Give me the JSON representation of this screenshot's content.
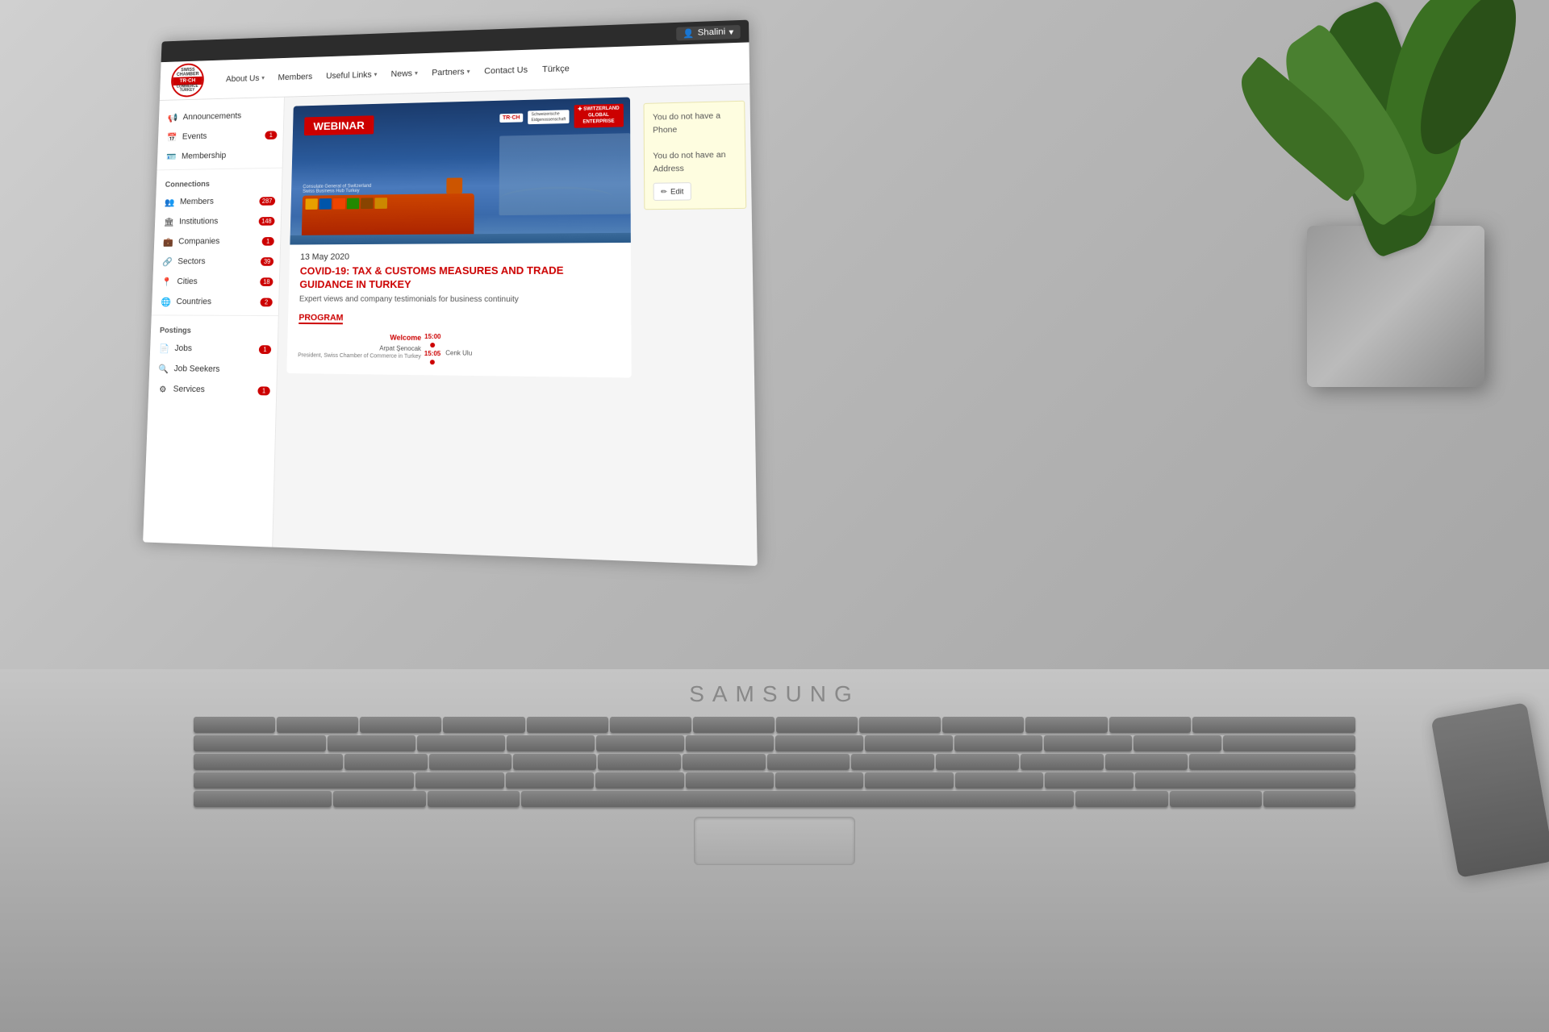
{
  "colors": {
    "primary": "#cc0000",
    "dark": "#2c2c2c",
    "light_bg": "#f5f5f5",
    "note_bg": "#fefde0",
    "sidebar_bg": "#ffffff"
  },
  "topbar": {
    "username": "Shalini",
    "dropdown_icon": "▾"
  },
  "navbar": {
    "logo_text": "TR·CH",
    "items": [
      {
        "label": "About Us",
        "has_dropdown": true
      },
      {
        "label": "Members",
        "has_dropdown": false
      },
      {
        "label": "Useful Links",
        "has_dropdown": true
      },
      {
        "label": "News",
        "has_dropdown": true
      },
      {
        "label": "Partners",
        "has_dropdown": true
      },
      {
        "label": "Contact Us",
        "has_dropdown": false
      },
      {
        "label": "Türkçe",
        "has_dropdown": false
      }
    ]
  },
  "sidebar": {
    "sections": [
      {
        "items": [
          {
            "label": "Announcements",
            "icon": "megaphone",
            "badge": null
          },
          {
            "label": "Events",
            "icon": "calendar",
            "badge": "1"
          },
          {
            "label": "Membership",
            "icon": "card",
            "badge": null
          }
        ]
      },
      {
        "header": "Connections",
        "items": [
          {
            "label": "Members",
            "icon": "people",
            "badge": "287"
          },
          {
            "label": "Institutions",
            "icon": "building",
            "badge": "148"
          },
          {
            "label": "Companies",
            "icon": "briefcase",
            "badge": "1"
          },
          {
            "label": "Sectors",
            "icon": "link",
            "badge": "39"
          },
          {
            "label": "Cities",
            "icon": "location",
            "badge": "18"
          },
          {
            "label": "Countries",
            "icon": "globe",
            "badge": "2"
          }
        ]
      },
      {
        "header": "Postings",
        "items": [
          {
            "label": "Jobs",
            "icon": "jobs",
            "badge": "1"
          },
          {
            "label": "Job Seekers",
            "icon": "person-search",
            "badge": null
          },
          {
            "label": "Services",
            "icon": "services",
            "badge": "1"
          }
        ]
      }
    ]
  },
  "webinar": {
    "tag": "WEBINAR",
    "date": "13 May 2020",
    "title": "COVID-19: TAX & CUSTOMS MEASURES AND TRADE GUIDANCE IN TURKEY",
    "subtitle": "Expert views and company testimonials for business continuity",
    "program_label": "PROGRAM",
    "program_items": [
      {
        "time": "15:00",
        "name": "Welcome",
        "speaker": "Arpat Şenocak",
        "role": "President, Swiss Chamber of Commerce in Turkey"
      },
      {
        "time": "15:05",
        "name": "",
        "speaker": "Cenk Ulu",
        "role": ""
      }
    ]
  },
  "info_box": {
    "phone_label": "You do not have a Phone",
    "address_label": "You do not have an Address",
    "edit_label": "Edit"
  },
  "brand": {
    "laptop": "SAMSUNG"
  }
}
